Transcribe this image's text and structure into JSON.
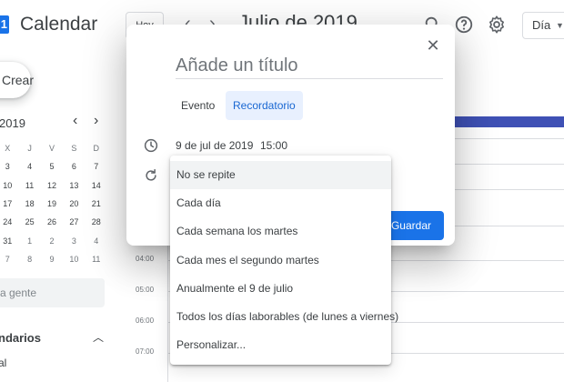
{
  "header": {
    "app_name": "Calendar",
    "today_label": "Hoy",
    "month_title": "Julio de 2019",
    "view_selected": "Día",
    "logo_glyph": "1"
  },
  "sidebar": {
    "create_label": "Crear",
    "mini_calendar": {
      "month_label": "2019",
      "weekday_headers": [
        "X",
        "J",
        "V",
        "S",
        "D"
      ],
      "rows": [
        [
          "3",
          "4",
          "5",
          "6",
          "7"
        ],
        [
          "10",
          "11",
          "12",
          "13",
          "14"
        ],
        [
          "17",
          "18",
          "19",
          "20",
          "21"
        ],
        [
          "24",
          "25",
          "26",
          "27",
          "28"
        ],
        [
          "31",
          "1",
          "2",
          "3",
          "4"
        ],
        [
          "7",
          "8",
          "9",
          "10",
          "11"
        ]
      ]
    },
    "people_search_placeholder": "a gente",
    "calendars_heading": "ndarios",
    "calendar_item": "al"
  },
  "day_grid": {
    "hours": [
      "04:00",
      "05:00",
      "06:00",
      "07:00"
    ],
    "event_color": "#3f51b5"
  },
  "dialog": {
    "title_placeholder": "Añade un título",
    "tabs": [
      {
        "label": "Evento",
        "active": false
      },
      {
        "label": "Recordatorio",
        "active": true
      }
    ],
    "date": "9 de jul de 2019",
    "time": "15:00",
    "save_label": "Guardar",
    "accent_color": "#1a73e8"
  },
  "repeat_menu": {
    "selected_index": 0,
    "options": [
      "No se repite",
      "Cada día",
      "Cada semana los martes",
      "Cada mes el segundo martes",
      "Anualmente el 9 de julio",
      "Todos los días laborables (de lunes a viernes)",
      "Personalizar..."
    ]
  }
}
